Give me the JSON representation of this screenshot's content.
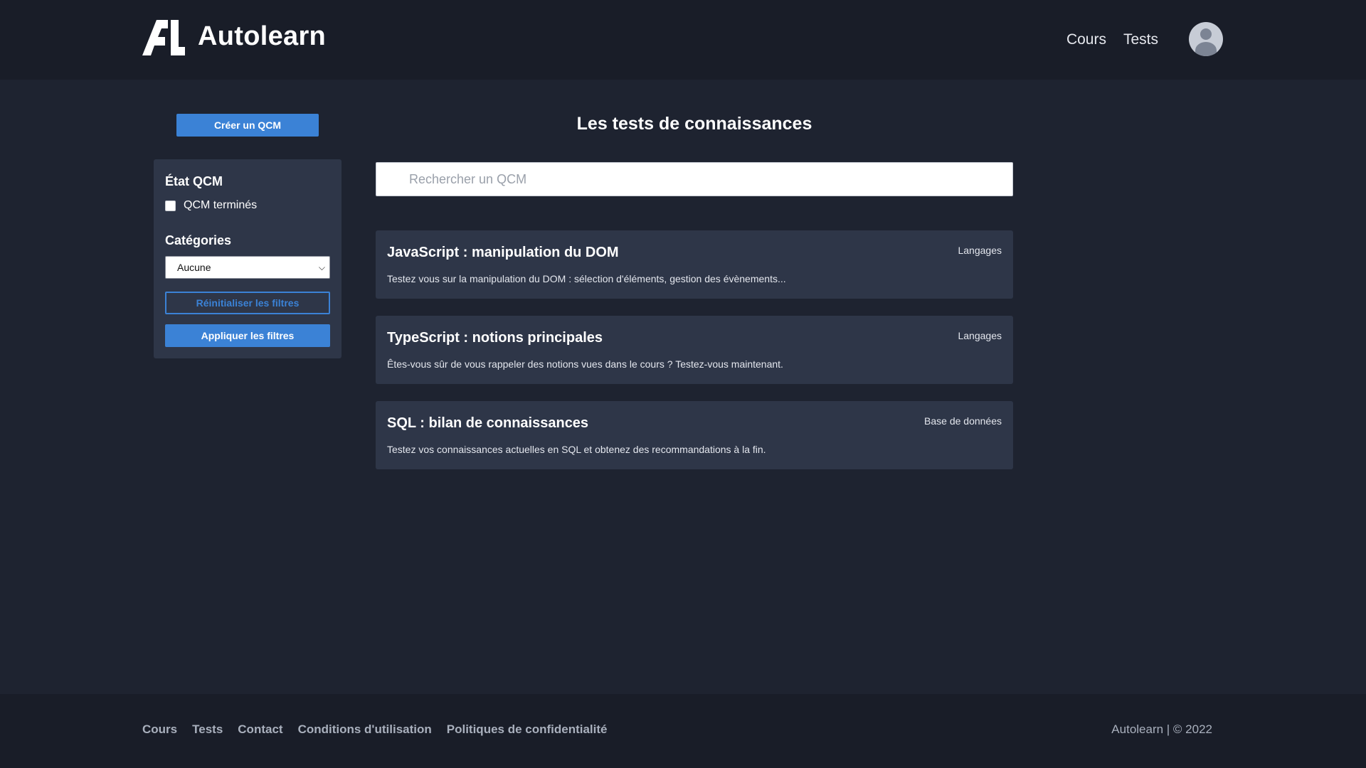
{
  "header": {
    "brand": "Autolearn",
    "nav": [
      {
        "label": "Cours"
      },
      {
        "label": "Tests"
      }
    ]
  },
  "sidebar": {
    "create_button": "Créer un QCM",
    "state_title": "État QCM",
    "completed_label": "QCM terminés",
    "completed_checked": false,
    "categories_title": "Catégories",
    "category_selected": "Aucune",
    "reset_button": "Réinitialiser les filtres",
    "apply_button": "Appliquer les filtres"
  },
  "main": {
    "title": "Les tests de connaissances",
    "search_placeholder": "Rechercher un QCM",
    "cards": [
      {
        "title": "JavaScript : manipulation du DOM",
        "category": "Langages",
        "description": "Testez vous sur la manipulation du DOM : sélection d'éléments, gestion des évènements..."
      },
      {
        "title": "TypeScript : notions principales",
        "category": "Langages",
        "description": "Êtes-vous sûr de vous rappeler des notions vues dans le cours ? Testez-vous maintenant."
      },
      {
        "title": "SQL : bilan de connaissances",
        "category": "Base de données",
        "description": "Testez vos connaissances actuelles en SQL et obtenez des recommandations à la fin."
      }
    ]
  },
  "footer": {
    "links": [
      {
        "label": "Cours"
      },
      {
        "label": "Tests"
      },
      {
        "label": "Contact"
      },
      {
        "label": "Conditions d'utilisation"
      },
      {
        "label": "Politiques de confidentialité"
      }
    ],
    "copyright": "Autolearn | © 2022"
  },
  "icons": {
    "logo": "autolearn-logo-icon",
    "avatar": "user-avatar-icon",
    "select_arrow": "chevron-down-icon"
  },
  "colors": {
    "accent": "#3b82d6",
    "background": "#1e2330",
    "header_bg": "#191d28",
    "card_bg": "#2e3648"
  }
}
